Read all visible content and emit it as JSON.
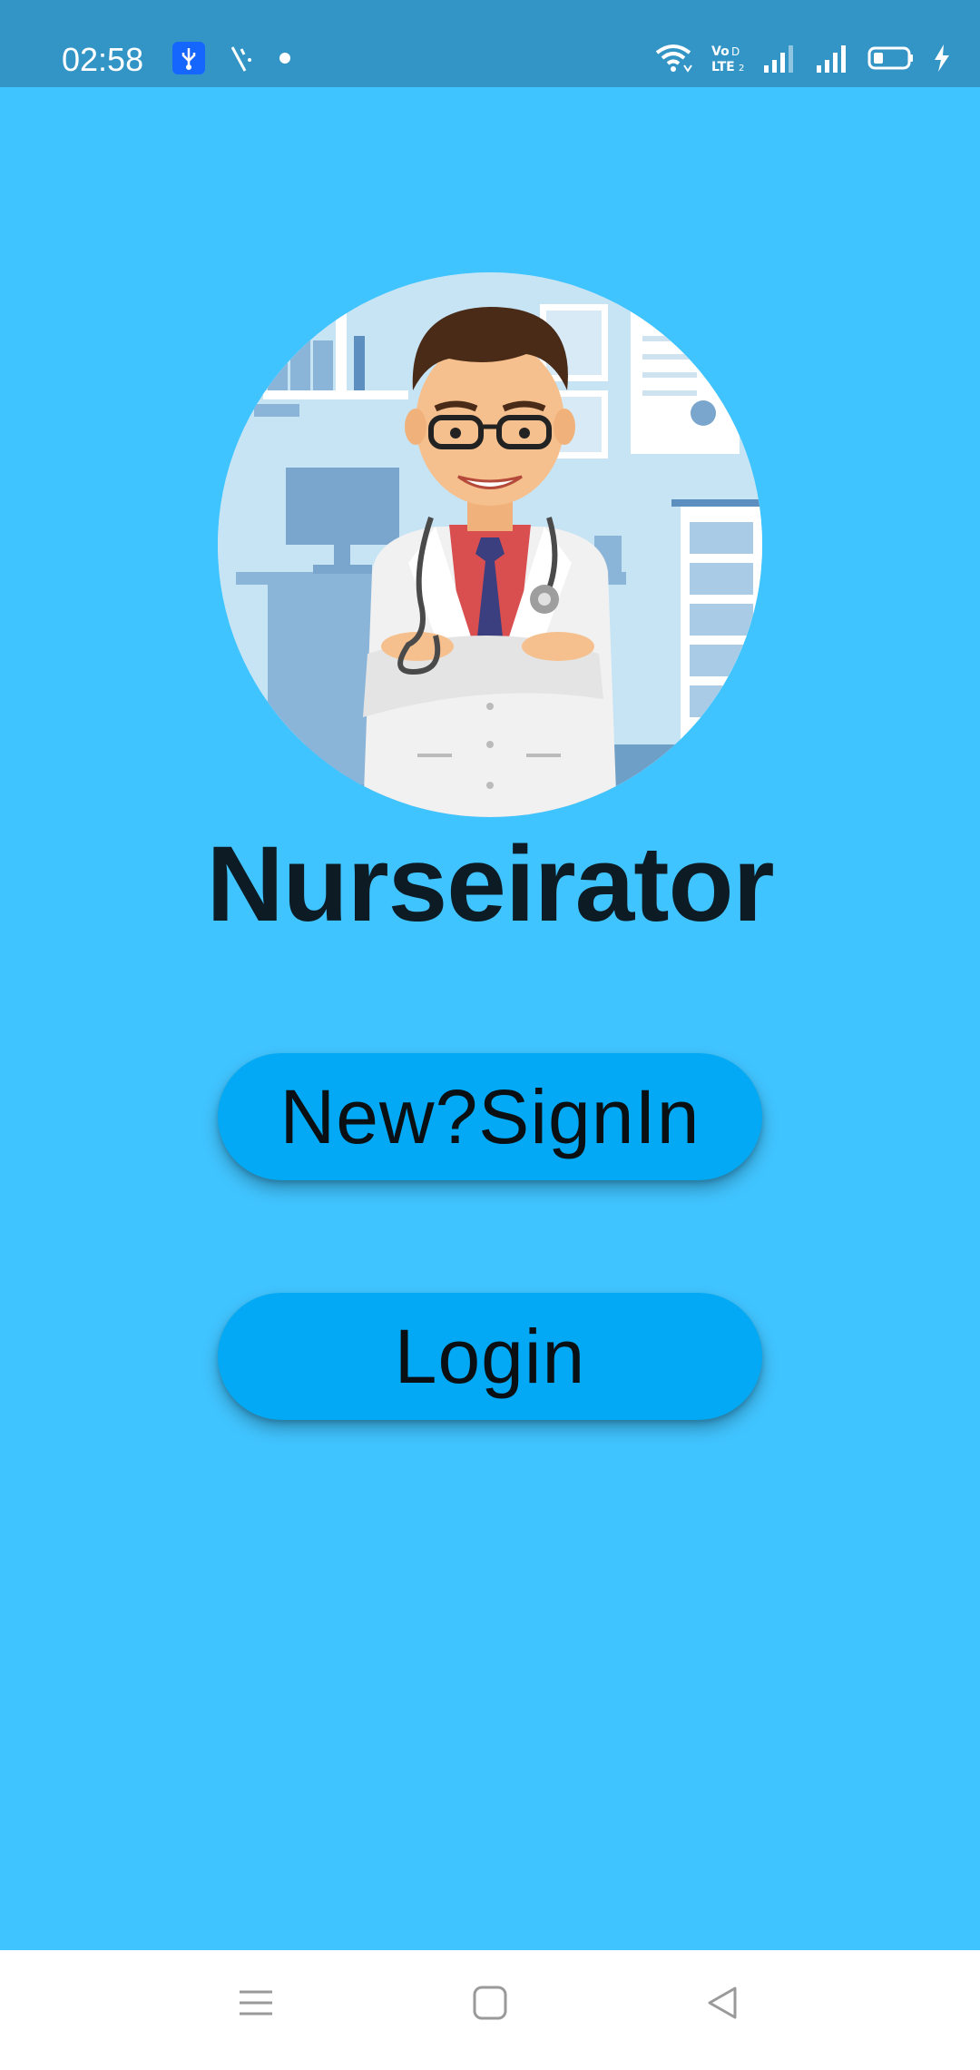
{
  "status_bar": {
    "time": "02:58",
    "left_icons": [
      "usb-debug-icon",
      "screen-record-icon",
      "notification-dot-icon"
    ],
    "right_icons": [
      "wifi-icon",
      "volte-icon",
      "signal-1-icon",
      "signal-2-icon",
      "battery-icon",
      "charging-icon"
    ]
  },
  "app": {
    "title": "Nurseirator",
    "logo": "doctor-illustration"
  },
  "buttons": {
    "signin_label": "New?SignIn",
    "login_label": "Login"
  },
  "nav_bar": {
    "icons": [
      "menu-icon",
      "home-icon",
      "back-icon"
    ]
  },
  "colors": {
    "background": "#40c4ff",
    "status_bar": "#3395c6",
    "button": "#03a9f4",
    "title": "#0d1b24"
  }
}
